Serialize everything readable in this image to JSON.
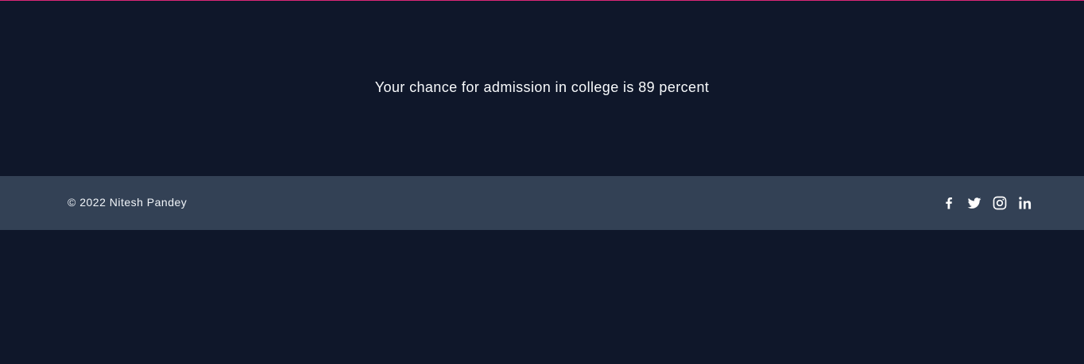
{
  "result": {
    "message": "Your chance for admission in college is 89 percent"
  },
  "footer": {
    "copyright": "© 2022 Nitesh Pandey",
    "social": [
      {
        "name": "facebook-icon"
      },
      {
        "name": "twitter-icon"
      },
      {
        "name": "instagram-icon"
      },
      {
        "name": "linkedin-icon"
      }
    ]
  },
  "colors": {
    "background": "#0f172a",
    "footer": "#334155",
    "accent": "#db2777",
    "text": "#f8fafc"
  }
}
